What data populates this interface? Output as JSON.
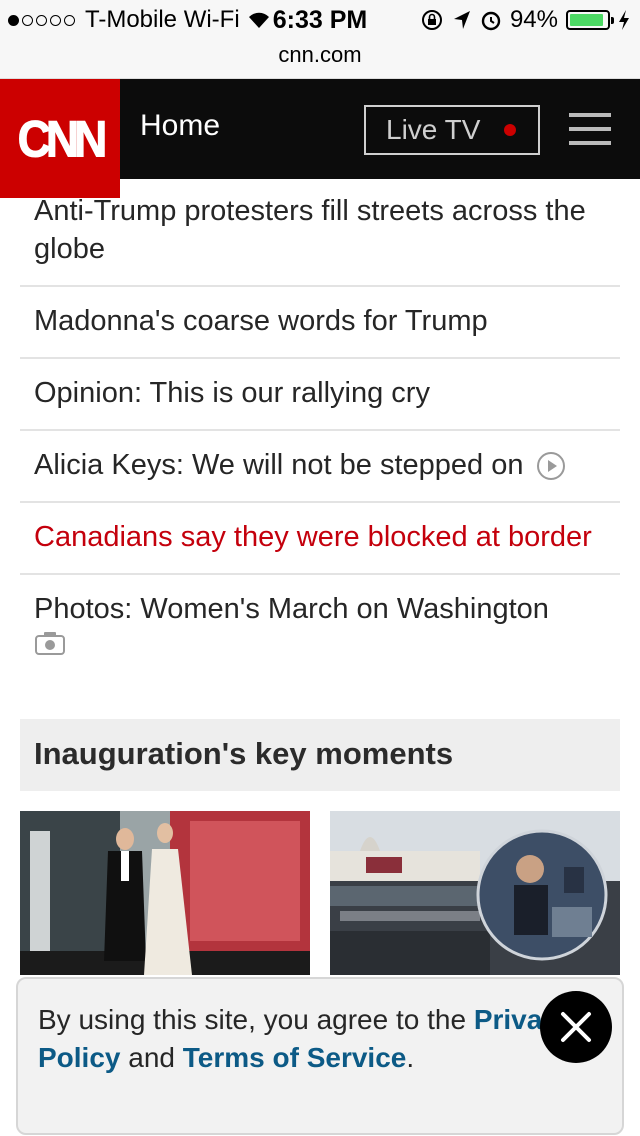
{
  "status_bar": {
    "carrier": "T-Mobile Wi-Fi",
    "time": "6:33 PM",
    "battery": "94%",
    "battery_level": 0.94
  },
  "url_bar": {
    "host": "cnn.com"
  },
  "header": {
    "logo_text": "CNN",
    "nav_label": "Home",
    "live_label": "Live TV",
    "brand_color": "#cc0000"
  },
  "headlines": [
    {
      "text": "Anti-Trump protesters fill streets across the globe"
    },
    {
      "text": "Madonna's coarse words for Trump"
    },
    {
      "text": "Opinion: This is our rallying cry"
    },
    {
      "text": "Alicia Keys: We will not be stepped on",
      "icon": "play-icon"
    },
    {
      "text": "Canadians say they were blocked at border",
      "color": "#c4000c"
    },
    {
      "text": "Photos: Women's March on Washington",
      "icon": "camera-icon"
    }
  ],
  "section": {
    "title": "Inauguration's key moments"
  },
  "consent": {
    "text_before": "By using this site, you agree to the ",
    "privacy_link": "Privacy Policy",
    "text_mid": " and ",
    "terms_link": "Terms of Service",
    "text_end": "."
  }
}
